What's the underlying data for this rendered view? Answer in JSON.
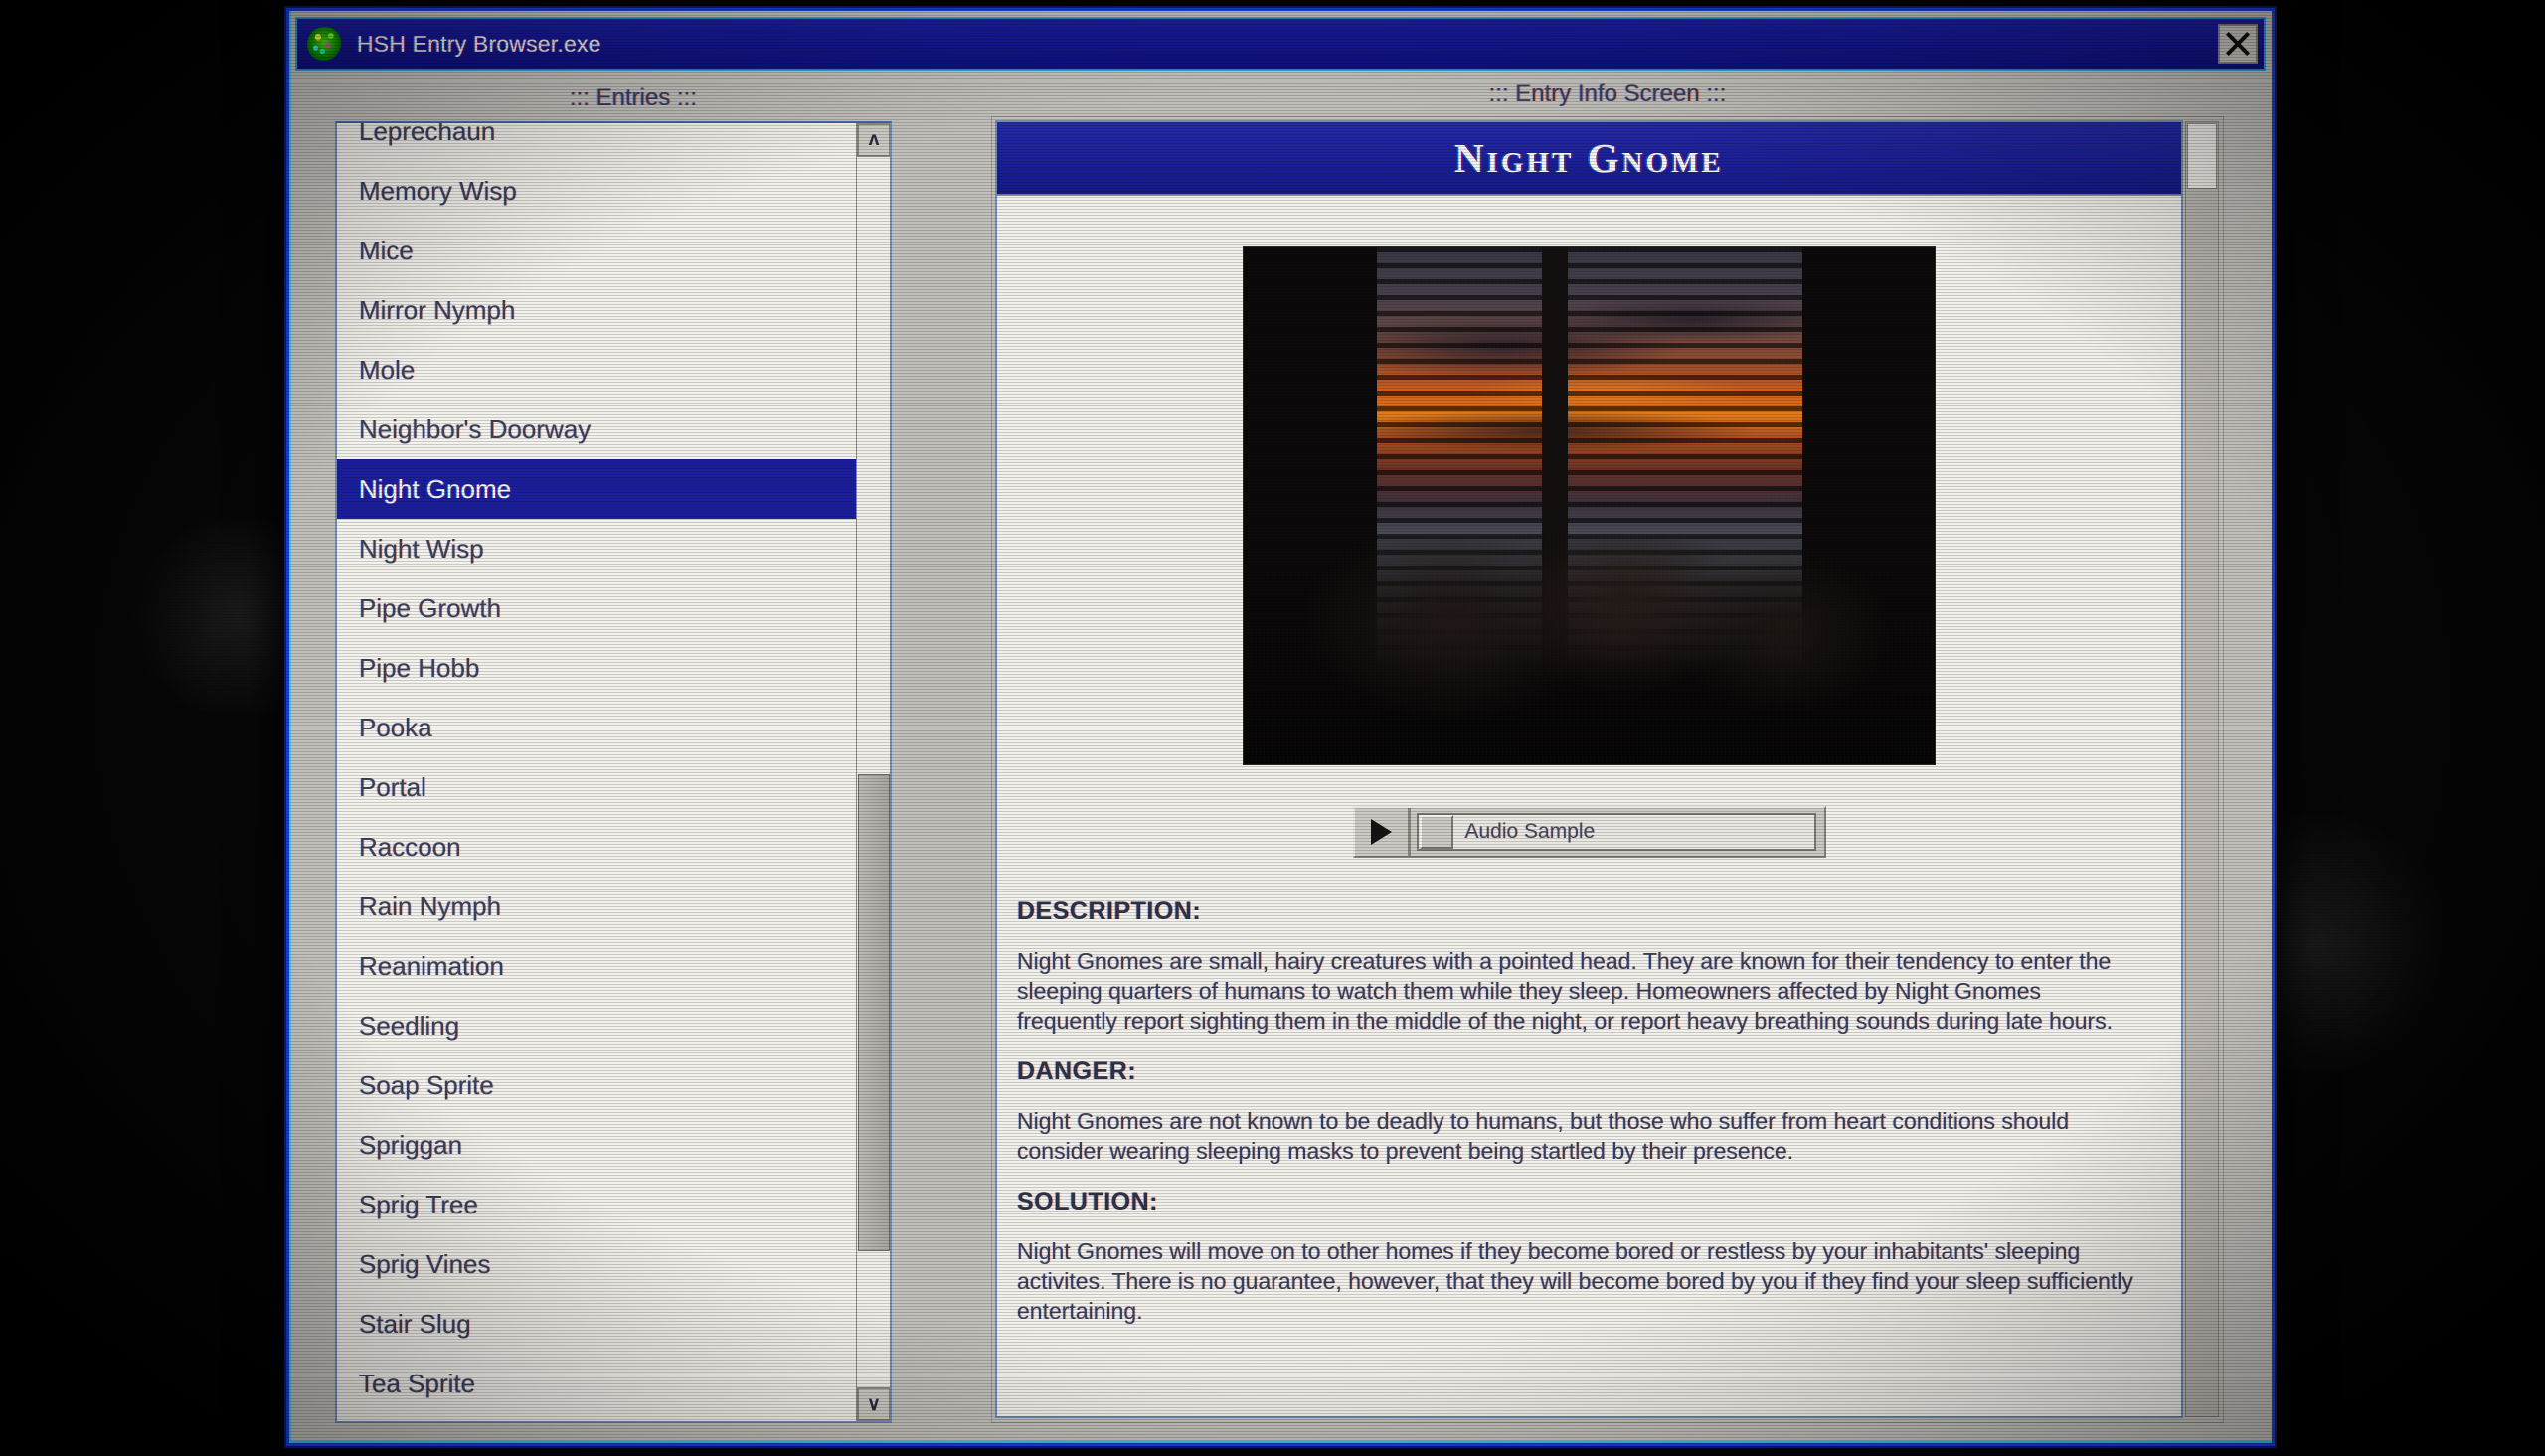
{
  "window": {
    "title": "HSH Entry Browser.exe",
    "icon": "creature-blob-icon",
    "close_label": "X",
    "accent_titlebar": "#1a1f9e",
    "accent_border": "#1a3fd8"
  },
  "panels": {
    "entries_heading": "::: Entries :::",
    "info_heading": "::: Entry Info Screen :::"
  },
  "entries": {
    "items": [
      {
        "label": "Leprechaun",
        "selected": false
      },
      {
        "label": "Memory Wisp",
        "selected": false
      },
      {
        "label": "Mice",
        "selected": false
      },
      {
        "label": "Mirror Nymph",
        "selected": false
      },
      {
        "label": "Mole",
        "selected": false
      },
      {
        "label": "Neighbor's Doorway",
        "selected": false
      },
      {
        "label": "Night Gnome",
        "selected": true
      },
      {
        "label": "Night Wisp",
        "selected": false
      },
      {
        "label": "Pipe Growth",
        "selected": false
      },
      {
        "label": "Pipe Hobb",
        "selected": false
      },
      {
        "label": "Pooka",
        "selected": false
      },
      {
        "label": "Portal",
        "selected": false
      },
      {
        "label": "Raccoon",
        "selected": false
      },
      {
        "label": "Rain Nymph",
        "selected": false
      },
      {
        "label": "Reanimation",
        "selected": false
      },
      {
        "label": "Seedling",
        "selected": false
      },
      {
        "label": "Soap Sprite",
        "selected": false
      },
      {
        "label": "Spriggan",
        "selected": false
      },
      {
        "label": "Sprig Tree",
        "selected": false
      },
      {
        "label": "Sprig Vines",
        "selected": false
      },
      {
        "label": "Stair Slug",
        "selected": false
      },
      {
        "label": "Tea Sprite",
        "selected": false
      }
    ],
    "scroll_up_glyph": "ʌ",
    "scroll_down_glyph": "∨"
  },
  "entry": {
    "title": "Night Gnome",
    "image_alt": "bedroom-window-sunset-photo",
    "audio": {
      "play_glyph": "▶",
      "label": "Audio Sample"
    },
    "sections": [
      {
        "heading": "DESCRIPTION:",
        "body": "Night Gnomes are small, hairy creatures with a pointed head. They are known for their tendency to enter the sleeping quarters of humans to watch them while they sleep. Homeowners affected by Night Gnomes frequently report sighting them in the middle of the night, or report heavy breathing sounds during late hours."
      },
      {
        "heading": "DANGER:",
        "body": "Night Gnomes are not known to be deadly to humans, but those who suffer from heart conditions should consider wearing sleeping masks to prevent being startled by their presence."
      },
      {
        "heading": "SOLUTION:",
        "body": "Night Gnomes will move on to other homes if they become bored or restless by your inhabitants' sleeping activites. There is no guarantee, however, that they will become bored by you if they find your sleep sufficiently entertaining."
      }
    ]
  }
}
